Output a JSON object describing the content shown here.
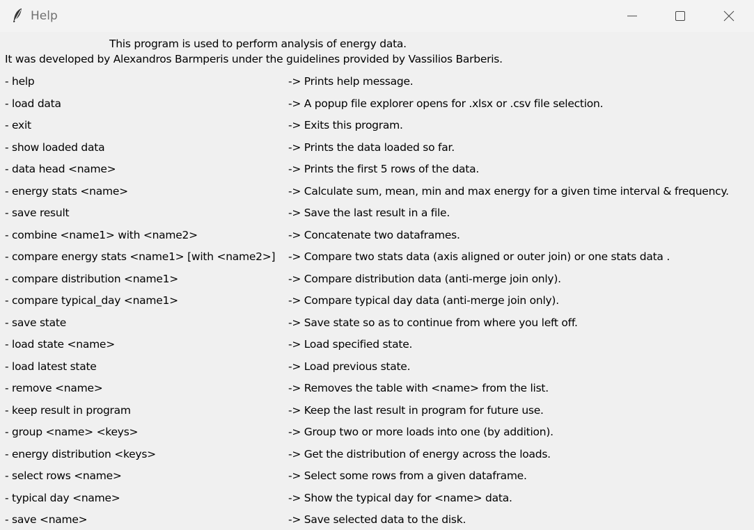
{
  "window": {
    "title": "Help",
    "icon": "feather-icon"
  },
  "intro": {
    "line1": "This program is used to perform analysis of energy data.",
    "line2": "It was developed by Alexandros Barmperis under the guidelines provided by Vassilios Barberis."
  },
  "commands": [
    {
      "name": "- help",
      "desc": "-> Prints help message."
    },
    {
      "name": "- load data",
      "desc": "-> A popup file explorer opens for .xlsx or .csv file selection."
    },
    {
      "name": "- exit",
      "desc": "-> Exits this program."
    },
    {
      "name": "- show loaded data",
      "desc": "-> Prints the data loaded so far."
    },
    {
      "name": "- data head <name>",
      "desc": "-> Prints the first 5 rows of the data."
    },
    {
      "name": "- energy stats <name>",
      "desc": "-> Calculate sum, mean, min and max energy for a given time interval & frequency."
    },
    {
      "name": "- save result",
      "desc": "-> Save the last result in a file."
    },
    {
      "name": "- combine <name1> with <name2>",
      "desc": "-> Concatenate two dataframes."
    },
    {
      "name": "- compare energy stats <name1> [with <name2>]",
      "desc": "-> Compare two stats data (axis aligned or outer join) or one stats data ."
    },
    {
      "name": "- compare distribution <name1>",
      "desc": "-> Compare distribution data (anti-merge join only)."
    },
    {
      "name": "- compare typical_day <name1>",
      "desc": "-> Compare typical day data (anti-merge join only)."
    },
    {
      "name": "- save state",
      "desc": "-> Save state so as to continue from where you left off."
    },
    {
      "name": "- load state <name>",
      "desc": "-> Load specified state."
    },
    {
      "name": "- load latest state",
      "desc": "-> Load previous state."
    },
    {
      "name": "- remove <name>",
      "desc": "-> Removes the table with <name> from the list."
    },
    {
      "name": "- keep result in program",
      "desc": "-> Keep the last result in program for future use."
    },
    {
      "name": "- group <name> <keys>",
      "desc": "-> Group two or more loads into one (by addition)."
    },
    {
      "name": "- energy distribution <keys>",
      "desc": "-> Get the distribution of energy across the loads."
    },
    {
      "name": "- select rows <name>",
      "desc": "-> Select some rows from a given dataframe."
    },
    {
      "name": "- typical day <name>",
      "desc": "-> Show the typical day for <name> data."
    },
    {
      "name": "- save <name>",
      "desc": "-> Save selected data to the disk."
    }
  ]
}
